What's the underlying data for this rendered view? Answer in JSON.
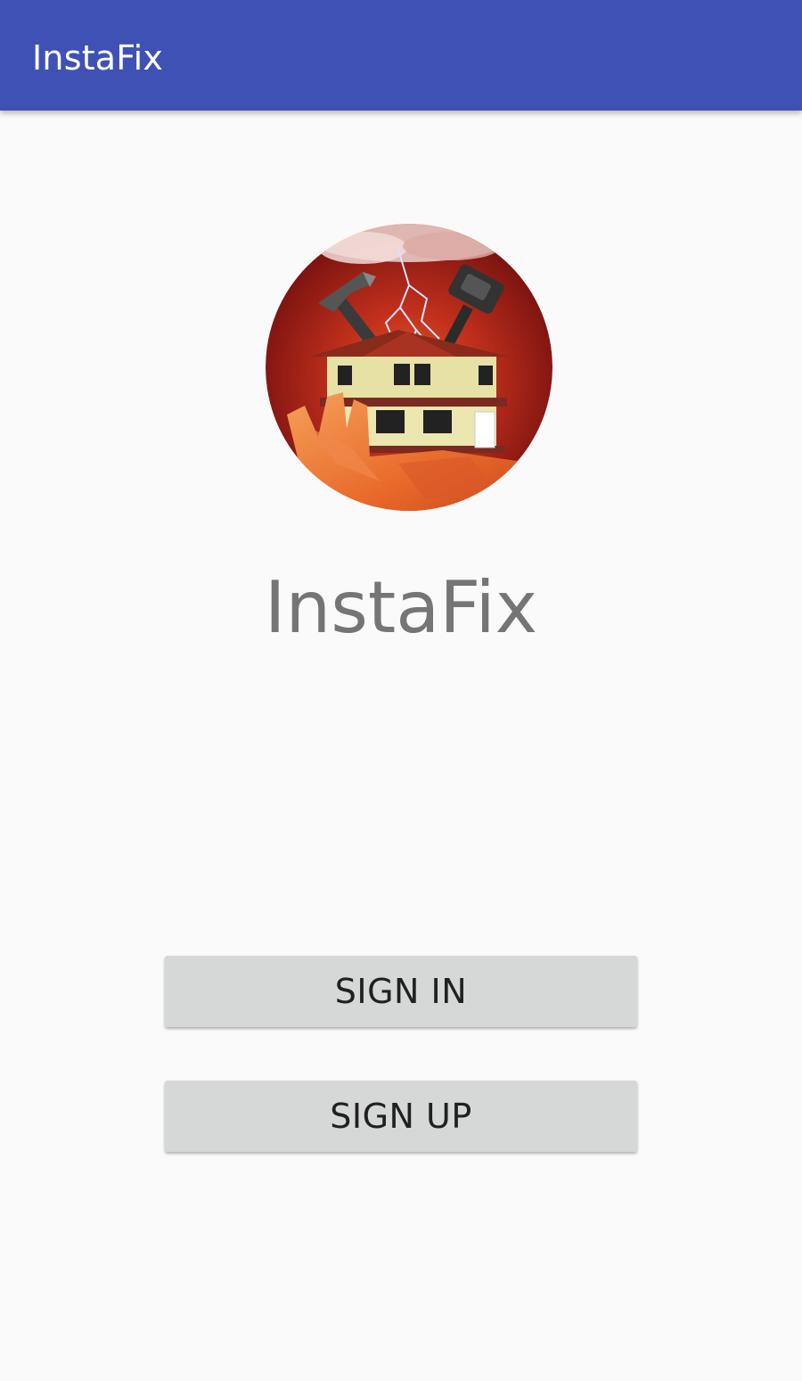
{
  "app_bar": {
    "title": "InstaFix",
    "color": "#3f51b5"
  },
  "logo": {
    "icon": "house-repair-logo-icon",
    "elements": [
      "hammer-icon",
      "sledgehammer-icon",
      "lightning-icon",
      "house-icon",
      "hand-icon"
    ]
  },
  "brand": {
    "title": "InstaFix"
  },
  "actions": {
    "sign_in_label": "SIGN IN",
    "sign_up_label": "SIGN UP"
  },
  "colors": {
    "background": "#fafafa",
    "button": "#d6d7d7",
    "title_text": "#757575"
  }
}
